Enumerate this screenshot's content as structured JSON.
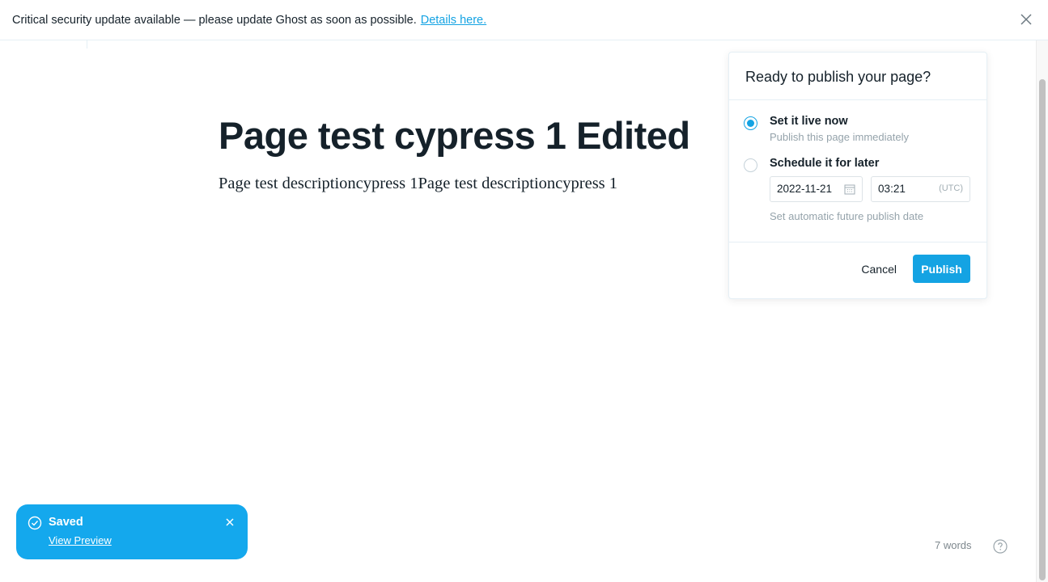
{
  "banner": {
    "message": "Critical security update available — please update Ghost as soon as possible.",
    "link_text": "Details here."
  },
  "editor": {
    "title": "Page test cypress 1 Edited",
    "body": "Page test descriptioncypress 1Page test descriptioncypress 1"
  },
  "publish_panel": {
    "heading": "Ready to publish your page?",
    "option_now": {
      "label": "Set it live now",
      "description": "Publish this page immediately",
      "selected": true
    },
    "option_later": {
      "label": "Schedule it for later",
      "date": "2022-11-21",
      "time": "03:21",
      "timezone": "(UTC)",
      "description": "Set automatic future publish date",
      "selected": false
    },
    "cancel_label": "Cancel",
    "publish_label": "Publish"
  },
  "toast": {
    "title": "Saved",
    "link_text": "View Preview"
  },
  "footer": {
    "word_count": "7 words"
  },
  "colors": {
    "accent": "#14a3e3",
    "text": "#15212a",
    "muted": "#95a3ab"
  }
}
